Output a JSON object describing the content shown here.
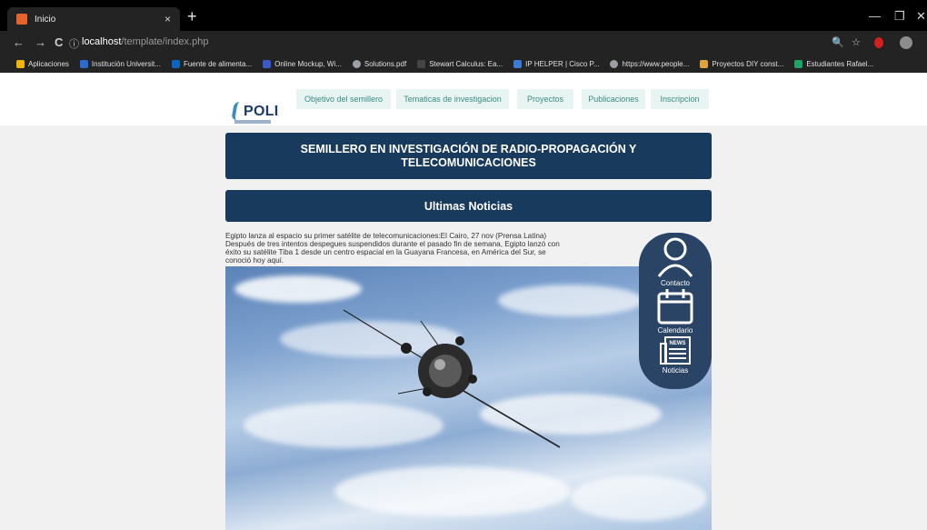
{
  "browser": {
    "tab_title": "Inicio",
    "tab_close": "×",
    "new_tab": "+",
    "url_host": "localhost",
    "url_path": "/template/index.php",
    "nav_back": "←",
    "nav_forward": "→",
    "nav_reload": "C",
    "site_info": "ⓘ",
    "win_min": "—",
    "win_max": "❐",
    "win_close": "✕",
    "zoom_icon": "🔍",
    "star_icon": "☆"
  },
  "bookmarks": [
    {
      "label": "Aplicaciones",
      "color": "#f4b400"
    },
    {
      "label": "Institución Universit...",
      "color": "#2a6bd1"
    },
    {
      "label": "Fuente de alimenta...",
      "color": "#0a66c2"
    },
    {
      "label": "Online Mockup, Wi...",
      "color": "#3b59c8"
    },
    {
      "label": "Solutions.pdf",
      "color": "#9aa0a6"
    },
    {
      "label": "Stewart Calculus: Ea...",
      "color": "#444444"
    },
    {
      "label": "IP HELPER | Cisco P...",
      "color": "#3a7bd5"
    },
    {
      "label": "https://www.people...",
      "color": "#9aa0a6"
    },
    {
      "label": "Proyectos DIY const...",
      "color": "#e2a23b"
    },
    {
      "label": "Estudiantes Rafael...",
      "color": "#1fa463"
    }
  ],
  "site": {
    "logo_text": "POLI",
    "menu": [
      "Objetivo del semillero",
      "Tematicas de investigacion",
      "Proyectos",
      "Publicaciones",
      "Inscripcion"
    ],
    "banner_title": "SEMILLERO EN INVESTIGACIÓN DE RADIO-PROPAGACIÓN Y TELECOMUNICACIONES",
    "news_heading": "Ultimas Noticias",
    "news_text": "Egipto lanza al espacio su primer satélite de telecomunicaciones:El Cairo, 27 nov (Prensa Latina) Después de tres intentos despegues suspendidos durante el pasado fin de semana, Egipto lanzó con éxito su satélite Tiba 1 desde un centro espacial en la Guayana Francesa, en América del Sur, se conoció hoy aquí.",
    "sidebar": {
      "contacto": "Contacto",
      "calendario": "Calendario",
      "noticias": "Noticias",
      "news_badge": "NEWS"
    }
  }
}
